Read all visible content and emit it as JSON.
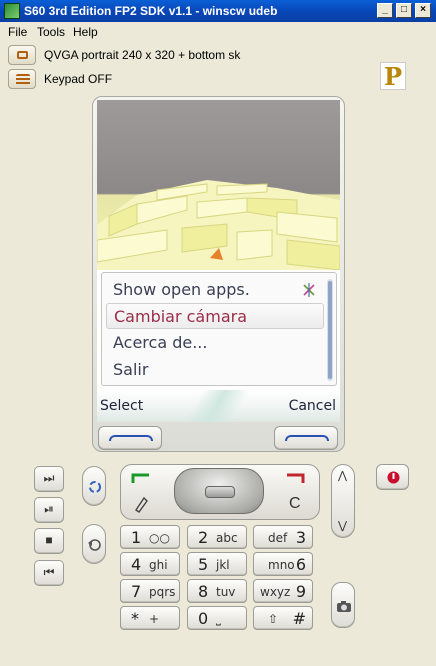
{
  "window": {
    "title": "S60 3rd Edition FP2 SDK v1.1 - winscw udeb",
    "controls": [
      "_",
      "□",
      "×"
    ]
  },
  "menubar": [
    "File",
    "Tools",
    "Help"
  ],
  "toolbar": {
    "layout_label": "QVGA portrait 240 x 320 + bottom sk",
    "keypad_label": "Keypad OFF",
    "logo_letter": "P"
  },
  "screen": {
    "menu_items": [
      "Show open apps.",
      "Cambiar cámara",
      "Acerca de...",
      "Salir"
    ],
    "selected_index": 1,
    "softkeys": {
      "left": "Select",
      "right": "Cancel"
    }
  },
  "keypad": {
    "rows": [
      [
        {
          "d": "1",
          "s": "○○"
        },
        {
          "d": "2",
          "s": "abc"
        },
        {
          "d": "3",
          "s": "def"
        }
      ],
      [
        {
          "d": "4",
          "s": "ghi"
        },
        {
          "d": "5",
          "s": "jkl"
        },
        {
          "d": "6",
          "s": "mno"
        }
      ],
      [
        {
          "d": "7",
          "s": "pqrs"
        },
        {
          "d": "8",
          "s": "tuv"
        },
        {
          "d": "9",
          "s": "wxyz"
        }
      ],
      [
        {
          "d": "*",
          "s": "+"
        },
        {
          "d": "0",
          "s": "⎵"
        },
        {
          "d": "#",
          "s": "⇧"
        }
      ]
    ],
    "side_left_glyphs": [
      "⏭",
      "⏯",
      "■",
      "⏮"
    ],
    "c_key": "C"
  },
  "colors": {
    "title_blue": "#0a5fd6",
    "selected_text": "#9b2d4a",
    "menu_text": "#3a3f55",
    "softkey_blue": "#2852b0"
  },
  "icons": [
    "app-icon",
    "layout-icon",
    "keypad-icon",
    "pen-icon",
    "camera-icon",
    "power-icon",
    "rotate-icon",
    "menu-sync-icon"
  ]
}
